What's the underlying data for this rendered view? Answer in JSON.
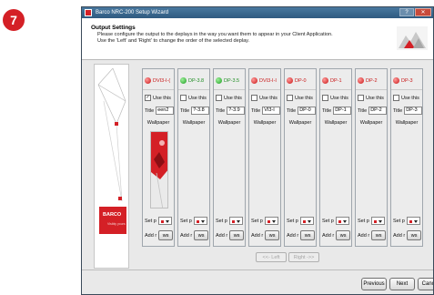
{
  "step": {
    "number": "7"
  },
  "window": {
    "title": "Barco NRC-200 Setup Wizard",
    "help": "?",
    "close": "✕"
  },
  "header": {
    "title": "Output Settings",
    "desc_line1": "Please configure the output to the deplays in the way you want them to appear in your Client Application.",
    "desc_line2": "Use the 'Left' and 'Right' to change the order of the selected deplay."
  },
  "branding": {
    "logo": "BARCO",
    "tagline": "Visibly yours"
  },
  "columns": [
    {
      "name": "DVI3-I-(",
      "status": "red",
      "use_label": "Use this",
      "checked": "✓",
      "title_label": "Title",
      "title_value": "een2",
      "wallpaper_label": "Wallpaper",
      "set_label": "Set p",
      "add_label": "Add r",
      "ws_label": "ws",
      "has_preview": true
    },
    {
      "name": "DP-3.8",
      "status": "green",
      "use_label": "Use this",
      "checked": "",
      "title_label": "Title",
      "title_value": "?-3.8",
      "wallpaper_label": "Wallpaper",
      "set_label": "Set p",
      "add_label": "Add r",
      "ws_label": "ws",
      "has_preview": false
    },
    {
      "name": "DP-3.5",
      "status": "green",
      "use_label": "Use this",
      "checked": "",
      "title_label": "Title",
      "title_value": "?-3.9",
      "wallpaper_label": "Wallpaper",
      "set_label": "Set p",
      "add_label": "Add r",
      "ws_label": "ws",
      "has_preview": false
    },
    {
      "name": "DVI3-I-I",
      "status": "red",
      "use_label": "Use this",
      "checked": "",
      "title_label": "Title",
      "title_value": "VI3-I",
      "wallpaper_label": "Wallpaper",
      "set_label": "Set p",
      "add_label": "Add r",
      "ws_label": "ws",
      "has_preview": false
    },
    {
      "name": "DP-0",
      "status": "red",
      "use_label": "Use this",
      "checked": "",
      "title_label": "Title",
      "title_value": "DP-0",
      "wallpaper_label": "Wallpaper",
      "set_label": "Set p",
      "add_label": "Add r",
      "ws_label": "ws",
      "has_preview": false
    },
    {
      "name": "DP-1",
      "status": "red",
      "use_label": "Use this",
      "checked": "",
      "title_label": "Title",
      "title_value": "DP-1",
      "wallpaper_label": "Wallpaper",
      "set_label": "Set p",
      "add_label": "Add r",
      "ws_label": "ws",
      "has_preview": false
    },
    {
      "name": "DP-2",
      "status": "red",
      "use_label": "Use this",
      "checked": "",
      "title_label": "Title",
      "title_value": "DP-2",
      "wallpaper_label": "Wallpaper",
      "set_label": "Set p",
      "add_label": "Add r",
      "ws_label": "ws",
      "has_preview": false
    },
    {
      "name": "DP-3",
      "status": "red",
      "use_label": "Use this",
      "checked": "",
      "title_label": "Title",
      "title_value": "DP-3",
      "wallpaper_label": "Wallpaper",
      "set_label": "Set p",
      "add_label": "Add r",
      "ws_label": "ws",
      "has_preview": false
    }
  ],
  "order_buttons": {
    "left": "<<- Left",
    "right": "Right ->>"
  },
  "nav": {
    "previous": "Previous",
    "next": "Next",
    "cancel": "Cancel"
  },
  "colors": {
    "barco_red": "#d42026",
    "status_green": "#1e9c22",
    "title_bar": "#2f5a80"
  }
}
